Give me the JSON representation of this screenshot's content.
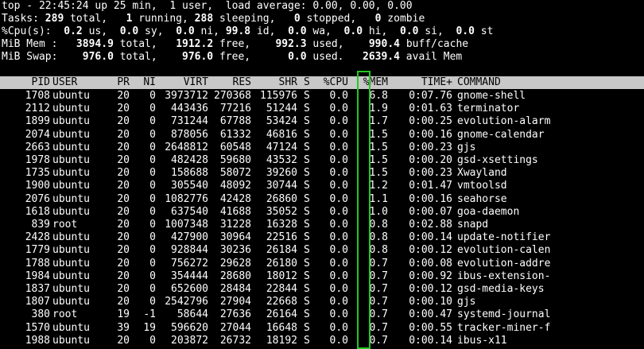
{
  "summary": {
    "top_prefix": "top - ",
    "time": "22:45:24",
    "up": " up 25 min,  1 user,  load average: 0.00, 0.00, 0.00",
    "tasks_label": "Tasks:",
    "tasks_total": " 289",
    "tasks_total_label": " total,   ",
    "tasks_running": "1",
    "tasks_running_label": " running, ",
    "tasks_sleeping": "288",
    "tasks_sleeping_label": " sleeping,   ",
    "tasks_stopped": "0",
    "tasks_stopped_label": " stopped,   ",
    "tasks_zombie": "0",
    "tasks_zombie_label": " zombie",
    "cpu_label": "%Cpu(s):",
    "cpu_us": "  0.2",
    "cpu_us_label": " us,  ",
    "cpu_sy": "0.0",
    "cpu_sy_label": " sy,  ",
    "cpu_ni": "0.0",
    "cpu_ni_label": " ni, ",
    "cpu_id": "99.8",
    "cpu_id_label": " id,  ",
    "cpu_wa": "0.0",
    "cpu_wa_label": " wa,  ",
    "cpu_hi": "0.0",
    "cpu_hi_label": " hi,  ",
    "cpu_si": "0.0",
    "cpu_si_label": " si,  ",
    "cpu_st": "0.0",
    "cpu_st_label": " st",
    "mem_label": "MiB Mem :",
    "mem_total": "   3894.9",
    "mem_total_label": " total,   ",
    "mem_free": "1912.2",
    "mem_free_label": " free,    ",
    "mem_used": "992.3",
    "mem_used_label": " used,    ",
    "mem_buff": "990.4",
    "mem_buff_label": " buff/cache",
    "swap_label": "MiB Swap:",
    "swap_total": "    976.0",
    "swap_total_label": " total,    ",
    "swap_free": "976.0",
    "swap_free_label": " free,      ",
    "swap_used": "0.0",
    "swap_used_label": " used.   ",
    "swap_avail": "2639.4",
    "swap_avail_label": " avail Mem"
  },
  "columns": {
    "pid": "PID",
    "user": "USER",
    "pr": "PR",
    "ni": "NI",
    "virt": "VIRT",
    "res": "RES",
    "shr": "SHR",
    "s": "S",
    "cpu": "%CPU",
    "mem": "%MEM",
    "time": "TIME+",
    "command": "COMMAND"
  },
  "processes": [
    {
      "pid": "1708",
      "user": "ubuntu",
      "pr": "20",
      "ni": "0",
      "virt": "3973712",
      "res": "270368",
      "shr": "115976",
      "s": "S",
      "cpu": "0.0",
      "mem": "6.8",
      "time": "0:07.76",
      "command": "gnome-shell"
    },
    {
      "pid": "2112",
      "user": "ubuntu",
      "pr": "20",
      "ni": "0",
      "virt": "443436",
      "res": "77216",
      "shr": "51244",
      "s": "S",
      "cpu": "0.0",
      "mem": "1.9",
      "time": "0:01.63",
      "command": "terminator"
    },
    {
      "pid": "1899",
      "user": "ubuntu",
      "pr": "20",
      "ni": "0",
      "virt": "731244",
      "res": "67788",
      "shr": "53424",
      "s": "S",
      "cpu": "0.0",
      "mem": "1.7",
      "time": "0:00.25",
      "command": "evolution-alarm"
    },
    {
      "pid": "2074",
      "user": "ubuntu",
      "pr": "20",
      "ni": "0",
      "virt": "878056",
      "res": "61332",
      "shr": "46816",
      "s": "S",
      "cpu": "0.0",
      "mem": "1.5",
      "time": "0:00.16",
      "command": "gnome-calendar"
    },
    {
      "pid": "2663",
      "user": "ubuntu",
      "pr": "20",
      "ni": "0",
      "virt": "2648812",
      "res": "60548",
      "shr": "47124",
      "s": "S",
      "cpu": "0.0",
      "mem": "1.5",
      "time": "0:00.23",
      "command": "gjs"
    },
    {
      "pid": "1978",
      "user": "ubuntu",
      "pr": "20",
      "ni": "0",
      "virt": "482428",
      "res": "59680",
      "shr": "43532",
      "s": "S",
      "cpu": "0.0",
      "mem": "1.5",
      "time": "0:00.20",
      "command": "gsd-xsettings"
    },
    {
      "pid": "1735",
      "user": "ubuntu",
      "pr": "20",
      "ni": "0",
      "virt": "158688",
      "res": "58072",
      "shr": "39260",
      "s": "S",
      "cpu": "0.0",
      "mem": "1.5",
      "time": "0:00.23",
      "command": "Xwayland"
    },
    {
      "pid": "1900",
      "user": "ubuntu",
      "pr": "20",
      "ni": "0",
      "virt": "305540",
      "res": "48092",
      "shr": "30744",
      "s": "S",
      "cpu": "0.0",
      "mem": "1.2",
      "time": "0:01.47",
      "command": "vmtoolsd"
    },
    {
      "pid": "2076",
      "user": "ubuntu",
      "pr": "20",
      "ni": "0",
      "virt": "1082776",
      "res": "42428",
      "shr": "26860",
      "s": "S",
      "cpu": "0.0",
      "mem": "1.1",
      "time": "0:00.16",
      "command": "seahorse"
    },
    {
      "pid": "1618",
      "user": "ubuntu",
      "pr": "20",
      "ni": "0",
      "virt": "637540",
      "res": "41688",
      "shr": "35052",
      "s": "S",
      "cpu": "0.0",
      "mem": "1.0",
      "time": "0:00.07",
      "command": "goa-daemon"
    },
    {
      "pid": "839",
      "user": "root",
      "pr": "20",
      "ni": "0",
      "virt": "1007348",
      "res": "31228",
      "shr": "16328",
      "s": "S",
      "cpu": "0.0",
      "mem": "0.8",
      "time": "0:02.88",
      "command": "snapd"
    },
    {
      "pid": "2428",
      "user": "ubuntu",
      "pr": "20",
      "ni": "0",
      "virt": "427900",
      "res": "30964",
      "shr": "22516",
      "s": "S",
      "cpu": "0.0",
      "mem": "0.8",
      "time": "0:00.14",
      "command": "update-notifier"
    },
    {
      "pid": "1779",
      "user": "ubuntu",
      "pr": "20",
      "ni": "0",
      "virt": "928844",
      "res": "30236",
      "shr": "26184",
      "s": "S",
      "cpu": "0.0",
      "mem": "0.8",
      "time": "0:00.12",
      "command": "evolution-calen"
    },
    {
      "pid": "1788",
      "user": "ubuntu",
      "pr": "20",
      "ni": "0",
      "virt": "756272",
      "res": "29628",
      "shr": "26180",
      "s": "S",
      "cpu": "0.0",
      "mem": "0.7",
      "time": "0:00.08",
      "command": "evolution-addre"
    },
    {
      "pid": "1984",
      "user": "ubuntu",
      "pr": "20",
      "ni": "0",
      "virt": "354444",
      "res": "28680",
      "shr": "18012",
      "s": "S",
      "cpu": "0.0",
      "mem": "0.7",
      "time": "0:00.92",
      "command": "ibus-extension-"
    },
    {
      "pid": "1837",
      "user": "ubuntu",
      "pr": "20",
      "ni": "0",
      "virt": "652600",
      "res": "28484",
      "shr": "22844",
      "s": "S",
      "cpu": "0.0",
      "mem": "0.7",
      "time": "0:00.12",
      "command": "gsd-media-keys"
    },
    {
      "pid": "1807",
      "user": "ubuntu",
      "pr": "20",
      "ni": "0",
      "virt": "2542796",
      "res": "27904",
      "shr": "22668",
      "s": "S",
      "cpu": "0.0",
      "mem": "0.7",
      "time": "0:00.10",
      "command": "gjs"
    },
    {
      "pid": "380",
      "user": "root",
      "pr": "19",
      "ni": "-1",
      "virt": "58644",
      "res": "27636",
      "shr": "26164",
      "s": "S",
      "cpu": "0.0",
      "mem": "0.7",
      "time": "0:00.47",
      "command": "systemd-journal"
    },
    {
      "pid": "1570",
      "user": "ubuntu",
      "pr": "39",
      "ni": "19",
      "virt": "596620",
      "res": "27044",
      "shr": "16648",
      "s": "S",
      "cpu": "0.0",
      "mem": "0.7",
      "time": "0:00.55",
      "command": "tracker-miner-f"
    },
    {
      "pid": "1988",
      "user": "ubuntu",
      "pr": "20",
      "ni": "0",
      "virt": "203872",
      "res": "26732",
      "shr": "18192",
      "s": "S",
      "cpu": "0.0",
      "mem": "0.7",
      "time": "0:00.14",
      "command": "ibus-x11"
    }
  ],
  "colors": {
    "background": "#000000",
    "text": "#ffffff",
    "header_bar": "#c8c8c8",
    "highlight_box": "#22c822"
  }
}
